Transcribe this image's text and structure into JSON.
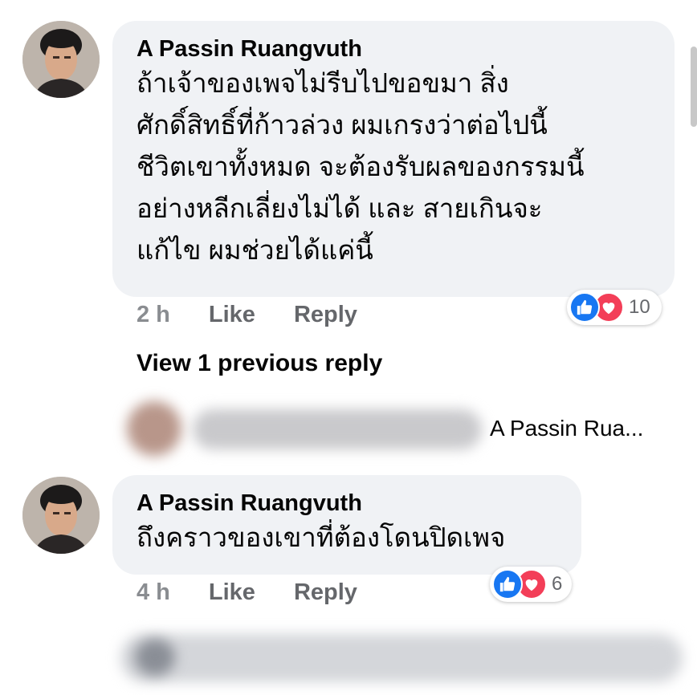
{
  "comments": [
    {
      "author": "A Passin Ruangvuth",
      "lines": [
        "ถ้าเจ้าของเพจไม่รีบไปขอขมา สิ่ง",
        "ศักดิ์สิทธิ์ที่ก้าวล่วง ผมเกรงว่าต่อไปนี้",
        "ชีวิตเขาทั้งหมด จะต้องรับผลของกรรมนี้",
        "อย่างหลีกเลี่ยงไม่ได้ และ สายเกินจะ",
        "แก้ไข ผมช่วยได้แค่นี้"
      ],
      "time": "2 h",
      "like_label": "Like",
      "reply_label": "Reply",
      "reaction_count": "10"
    },
    {
      "author": "A Passin Ruangvuth",
      "lines": [
        "ถึงคราวของเขาที่ต้องโดนปิดเพจ"
      ],
      "time": "4 h",
      "like_label": "Like",
      "reply_label": "Reply",
      "reaction_count": "6"
    }
  ],
  "view_previous_label": "View 1 previous reply",
  "reply_preview_text": "A Passin Rua...",
  "icons": {
    "like": "like-reaction-icon",
    "love": "love-reaction-icon"
  },
  "colors": {
    "like_blue": "#1877f2",
    "love_red": "#f33e58",
    "bubble_bg": "#f0f2f5",
    "meta_gray": "#65676b"
  }
}
